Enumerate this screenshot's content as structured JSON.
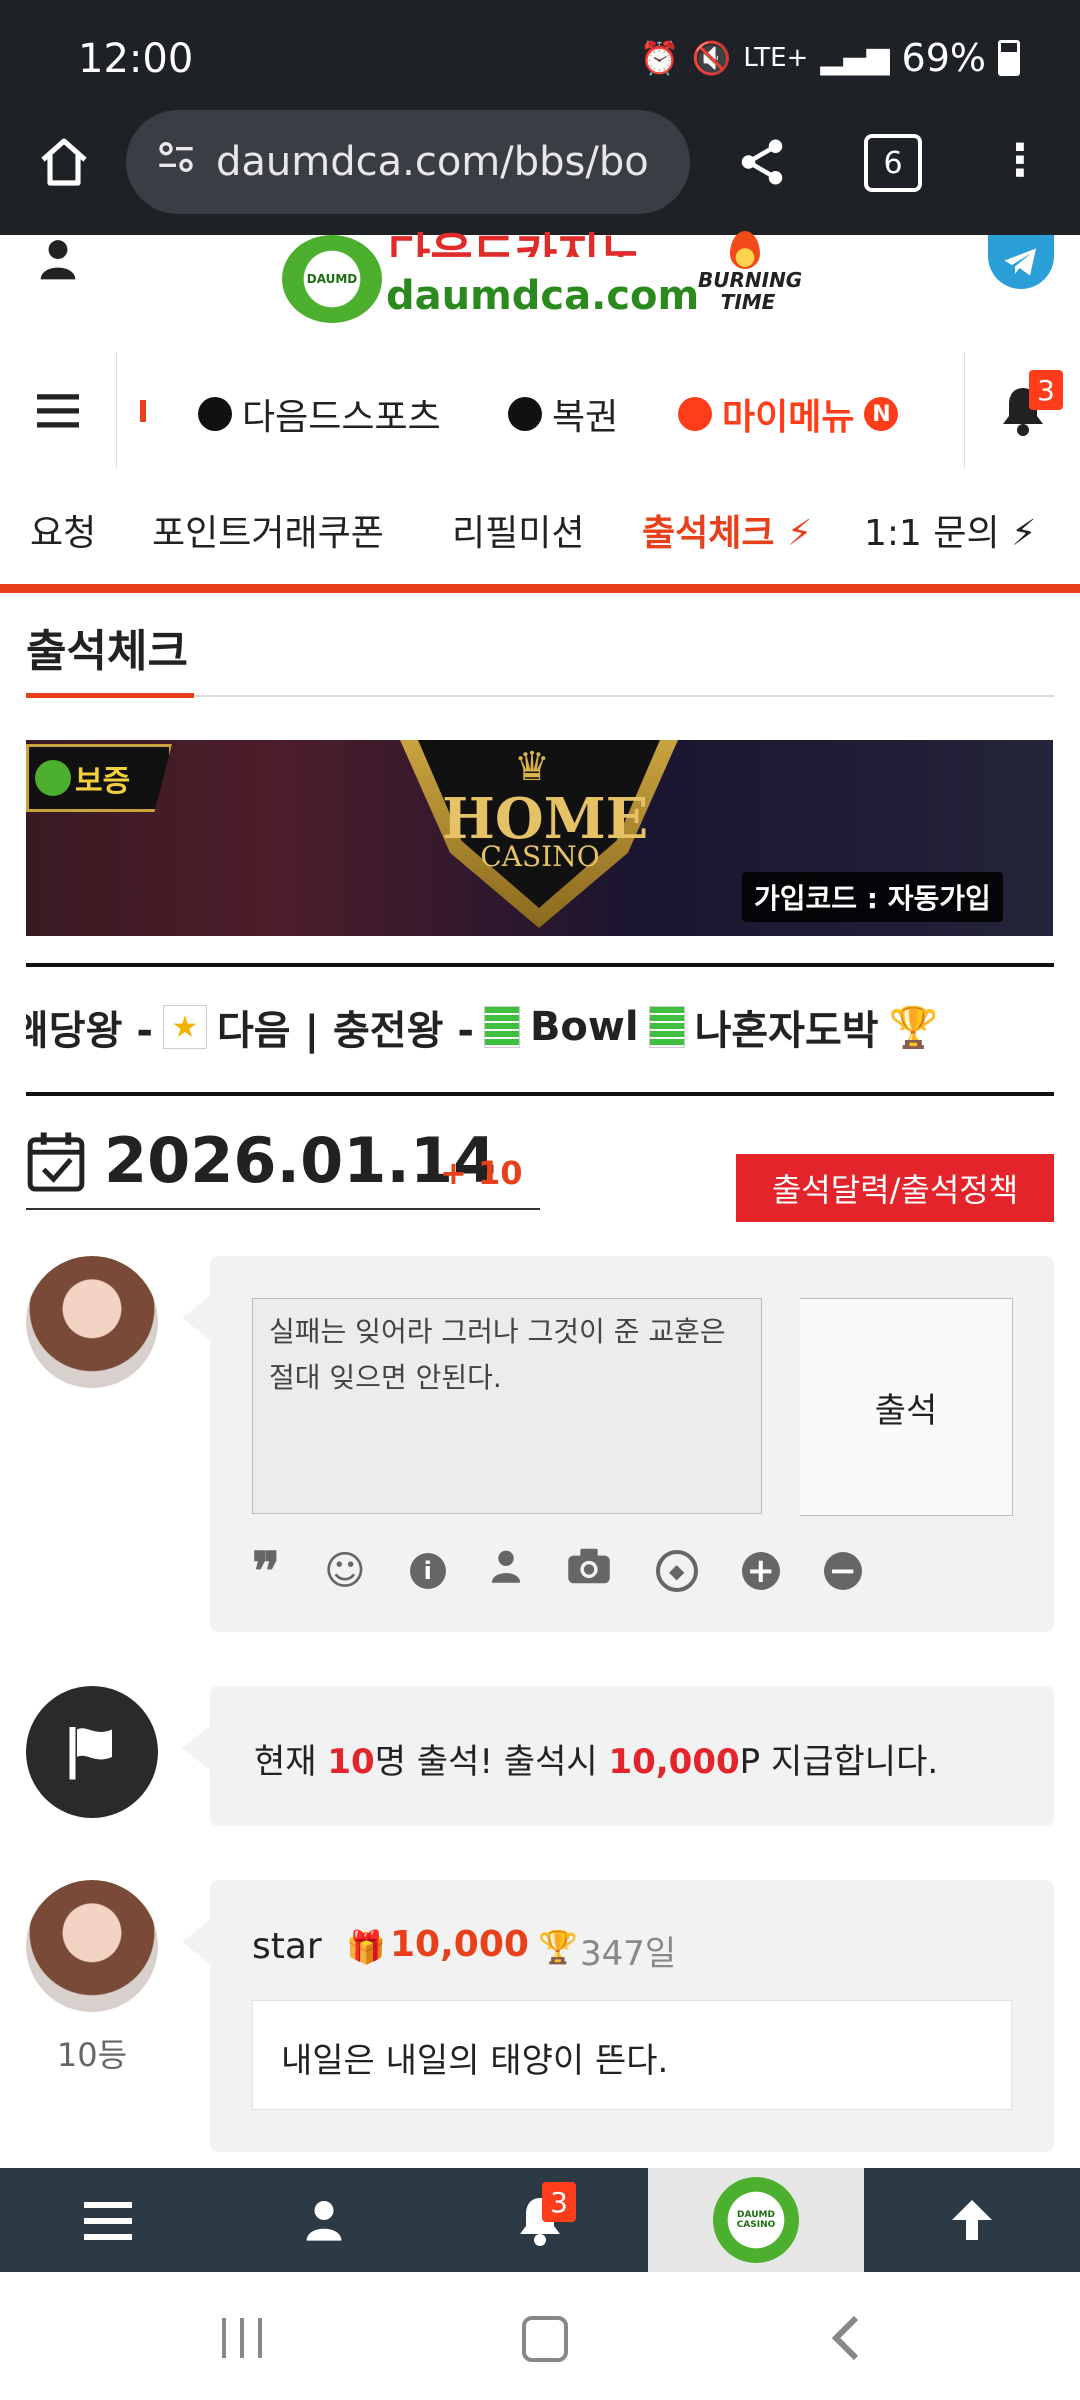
{
  "status": {
    "time": "12:00",
    "battery": "69%"
  },
  "browser": {
    "url": "daumdca.com/bbs/bo",
    "tabs": "6"
  },
  "logo": {
    "korean": "다음드카지노",
    "domain": "daumdca.com",
    "burning": "BURNING TIME"
  },
  "nav": {
    "items": [
      "다음드스포츠",
      "복권",
      "마이메뉴"
    ],
    "new_badge": "N",
    "bell_count": "3"
  },
  "subnav": {
    "items": [
      "요청",
      "포인트거래쿠폰",
      "리필미션",
      "출석체크",
      "1:1 문의"
    ]
  },
  "page": {
    "title": "출석체크"
  },
  "banner": {
    "badge": "보증",
    "brand_top": "HOME",
    "brand_bottom": "CASINO",
    "code": "가입코드 : 자동가입"
  },
  "marquee": {
    "seg1": "왜당왕 -",
    "seg2": "다음 | 충전왕 -",
    "seg3": "Bowl",
    "seg4": "나혼자도박"
  },
  "date": {
    "value": "2026.01.14",
    "plus": "+ 10",
    "button": "출석달력/출석정책"
  },
  "compose": {
    "text": "실패는 잊어라 그러나 그것이 준 교훈은 절대 잊으면 안된다.",
    "submit": "출석"
  },
  "notice": {
    "prefix": "현재 ",
    "count": "10",
    "mid": "명 출석! 출석시 ",
    "points": "10,000",
    "suffix": "P 지급합니다."
  },
  "entry": {
    "user": "star",
    "points": "10,000",
    "days": "347일",
    "rank": "10등",
    "message": "내일은 내일의 태양이 뜬다."
  },
  "bottom": {
    "bell_count": "3",
    "logo_text": "DAUMD CASINO"
  }
}
